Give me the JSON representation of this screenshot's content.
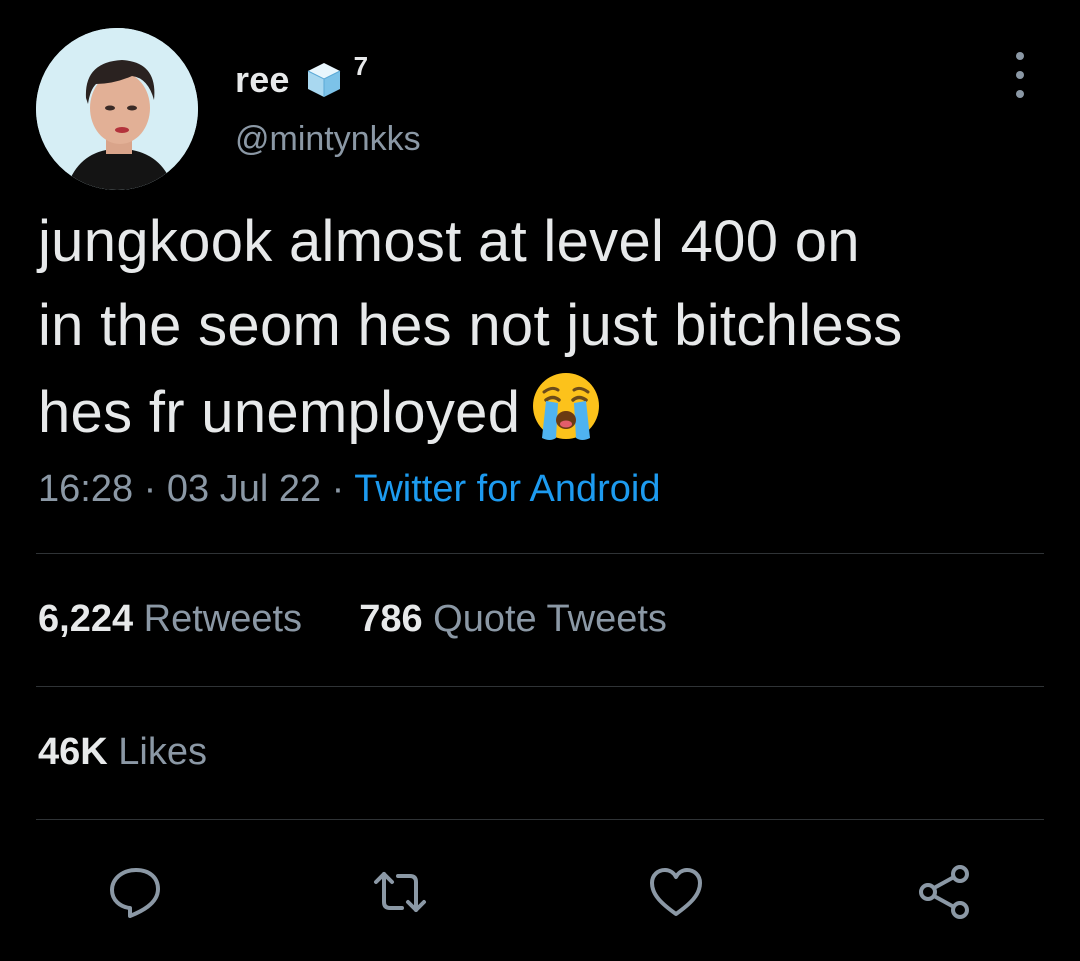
{
  "author": {
    "display_name": "ree",
    "name_suffix": "7",
    "handle": "@mintynkks",
    "verified_icon": "ice-cube-emoji"
  },
  "tweet": {
    "text_line1": "jungkook almost at level 400 on",
    "text_line2": "in the seom hes not just bitchless",
    "text_line3": "hes fr unemployed",
    "emoji": "loudly-crying-face-emoji",
    "time": "16:28",
    "separator": "·",
    "date": "03 Jul 22",
    "source": "Twitter for Android"
  },
  "stats": {
    "retweets_count": "6,224",
    "retweets_label": "Retweets",
    "quotes_count": "786",
    "quotes_label": "Quote Tweets",
    "likes_count": "46K",
    "likes_label": "Likes"
  },
  "actions": {
    "reply": "reply-icon",
    "retweet": "retweet-icon",
    "like": "heart-icon",
    "share": "share-icon"
  },
  "colors": {
    "background": "#000000",
    "text": "#e7e9ea",
    "secondary": "#8b98a5",
    "accent": "#1d9bf0",
    "divider": "#2f3336"
  }
}
